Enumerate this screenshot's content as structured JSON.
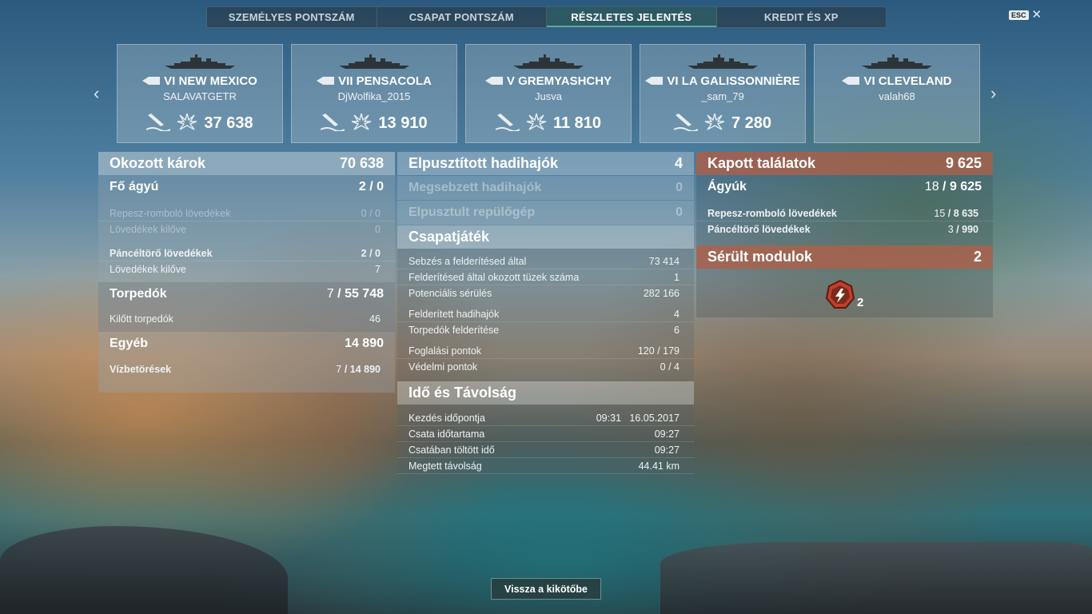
{
  "tabs": [
    {
      "label": "SZEMÉLYES PONTSZÁM",
      "active": false
    },
    {
      "label": "CSAPAT PONTSZÁM",
      "active": false
    },
    {
      "label": "RÉSZLETES JELENTÉS",
      "active": true
    },
    {
      "label": "KREDIT ÉS XP",
      "active": false
    }
  ],
  "esc_label": "ESC",
  "ships": [
    {
      "tier": "VI",
      "name": "NEW MEXICO",
      "player": "SALAVATGETR",
      "damage": "37 638",
      "icon": "battleship-icon"
    },
    {
      "tier": "VII",
      "name": "PENSACOLA",
      "player": "DjWolfika_2015",
      "damage": "13 910",
      "icon": "cruiser-icon"
    },
    {
      "tier": "V",
      "name": "GREMYASHCHY",
      "player": "Jusva",
      "damage": "11 810",
      "icon": "destroyer-icon"
    },
    {
      "tier": "VI",
      "name": "LA GALISSONNIÈRE",
      "player": "_sam_79",
      "damage": "7 280",
      "icon": "cruiser-icon"
    },
    {
      "tier": "VI",
      "name": "CLEVELAND",
      "player": "valah68",
      "damage": "",
      "icon": "cruiser-icon"
    }
  ],
  "damage": {
    "title": "Okozott károk",
    "total": "70 638",
    "main_battery": {
      "label": "Fő ágyú",
      "hits": "2",
      "value": "0"
    },
    "he": {
      "label": "Repesz-romboló lövedékek",
      "hits": "0",
      "value": "0"
    },
    "he_fired": {
      "label": "Lövedékek kilőve",
      "value": "0"
    },
    "ap": {
      "label": "Páncéltörő lövedékek",
      "hits": "2",
      "value": "0"
    },
    "ap_fired": {
      "label": "Lövedékek kilőve",
      "value": "7"
    },
    "torpedoes": {
      "label": "Torpedók",
      "hits": "7",
      "value": "55 748"
    },
    "torp_fired": {
      "label": "Kilőtt torpedók",
      "value": "46"
    },
    "other": {
      "label": "Egyéb",
      "value": "14 890"
    },
    "flooding": {
      "label": "Vízbetörések",
      "hits": "7",
      "value": "14 890"
    }
  },
  "results": {
    "destroyed": {
      "label": "Elpusztított hadihajók",
      "value": "4"
    },
    "damaged": {
      "label": "Megsebzett hadihajók",
      "value": "0"
    },
    "planes": {
      "label": "Elpusztult repülőgép",
      "value": "0"
    }
  },
  "teamplay": {
    "title": "Csapatjáték",
    "rows": [
      {
        "label": "Sebzés a felderítésed által",
        "value": "73 414"
      },
      {
        "label": "Felderítésed által okozott tüzek száma",
        "value": "1"
      },
      {
        "label": "Potenciális sérülés",
        "value": "282 166"
      },
      {
        "label": "Felderített hadihajók",
        "value": "4"
      },
      {
        "label": "Torpedók felderítése",
        "value": "6"
      },
      {
        "label": "Foglalási pontok",
        "value": "120 / 179"
      },
      {
        "label": "Védelmi pontok",
        "value": "0 / 4"
      }
    ]
  },
  "time": {
    "title": "Idő és Távolság",
    "rows": [
      {
        "label": "Kezdés időpontja",
        "value": "09:31   16.05.2017"
      },
      {
        "label": "Csata időtartama",
        "value": "09:27"
      },
      {
        "label": "Csatában töltött idő",
        "value": "09:27"
      },
      {
        "label": "Megtett távolság",
        "value": "44.41 km"
      }
    ]
  },
  "received": {
    "title": "Kapott találatok",
    "total": "9 625",
    "guns": {
      "label": "Ágyúk",
      "hits": "18",
      "value": "9 625"
    },
    "he": {
      "label": "Repesz-romboló lövedékek",
      "hits": "15",
      "value": "8 635"
    },
    "ap": {
      "label": "Páncéltörő lövedékek",
      "hits": "3",
      "value": "990"
    }
  },
  "modules": {
    "title": "Sérült modulok",
    "value": "2",
    "icon_count": "2"
  },
  "back_button": "Vissza a kikötőbe",
  "colors": {
    "active_tab": "#2d5f64",
    "received_header": "#b06048"
  }
}
